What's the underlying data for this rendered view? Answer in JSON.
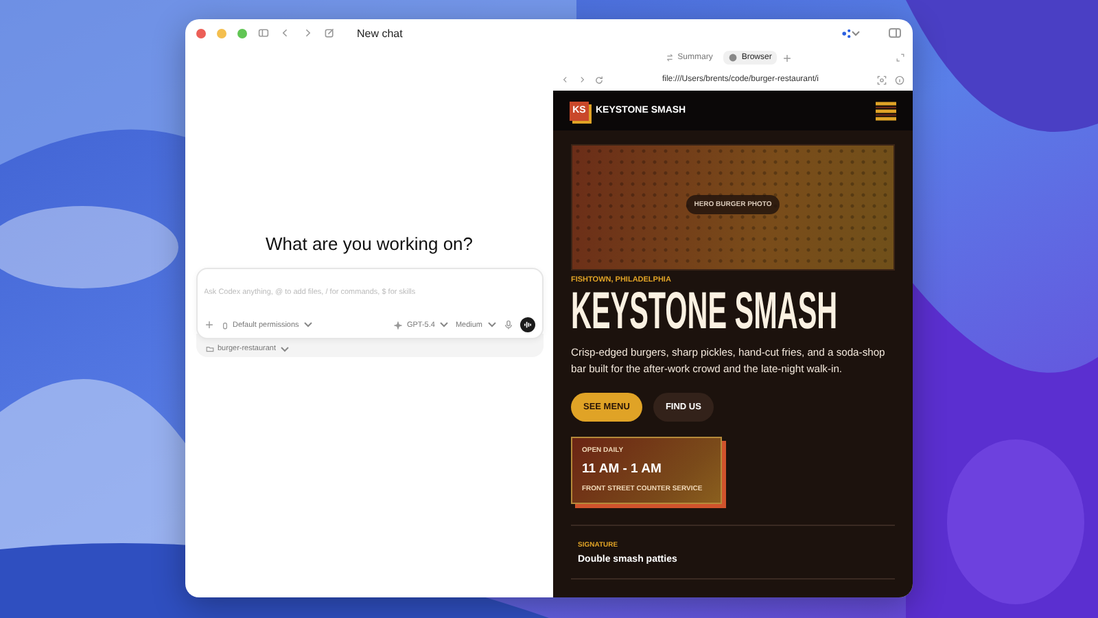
{
  "window": {
    "title": "New chat"
  },
  "chat": {
    "heading": "What are you working on?",
    "composer": {
      "placeholder": "Ask Codex anything, @ to add files, / for commands, $ for skills",
      "permissions": "Default permissions",
      "model": "GPT-5.4",
      "effort": "Medium"
    },
    "project": "burger-restaurant"
  },
  "panel": {
    "tabs": [
      {
        "label": "Summary",
        "selected": false
      },
      {
        "label": "Browser",
        "selected": true
      }
    ],
    "address": "file:///Users/brents/code/burger-restaurant/i"
  },
  "site": {
    "logo": "KS",
    "name": "KEYSTONE SMASH",
    "hero_label": "HERO BURGER PHOTO",
    "eyebrow": "FISHTOWN, PHILADELPHIA",
    "title": "KEYSTONE SMASH",
    "description": "Crisp-edged burgers, sharp pickles, hand-cut fries, and a soda-shop bar built for the after-work crowd and the late-night walk-in.",
    "buttons": [
      {
        "label": "SEE MENU",
        "kind": "primary"
      },
      {
        "label": "FIND US",
        "kind": "secondary"
      }
    ],
    "hours": {
      "label": "OPEN DAILY",
      "time": "11 AM - 1 AM",
      "note": "FRONT STREET COUNTER SERVICE"
    },
    "features": [
      {
        "label": "SIGNATURE",
        "text": "Double smash patties"
      }
    ]
  }
}
